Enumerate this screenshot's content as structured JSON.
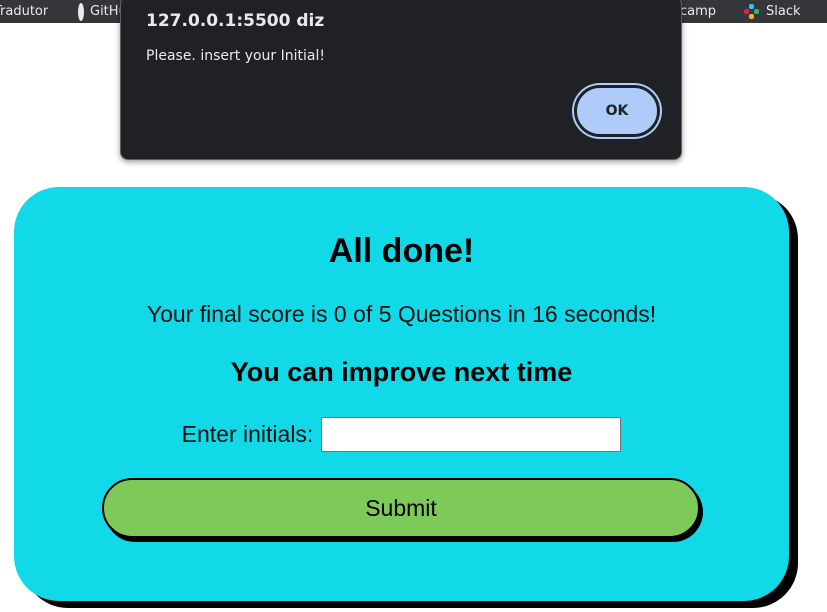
{
  "bookmarks": [
    {
      "label": "Tradutor",
      "icon": "translate-icon"
    },
    {
      "label": "GitHub",
      "icon": "github-icon"
    },
    {
      "label": "camp",
      "icon": "bookmark-icon"
    },
    {
      "label": "Slack",
      "icon": "slack-icon"
    }
  ],
  "dialog": {
    "title": "127.0.0.1:5500 diz",
    "message": "Please. insert your Initial!",
    "ok_label": "OK"
  },
  "quiz": {
    "title": "All done!",
    "score_text": "Your final score is 0 of 5 Questions in 16 seconds!",
    "subtitle": "You can improve next time",
    "initials_label": "Enter initials:",
    "initials_value": "",
    "initials_placeholder": "",
    "submit_label": "Submit"
  },
  "colors": {
    "card_bg": "#12d9e8",
    "submit_bg": "#7dc95a",
    "dialog_bg": "#202124",
    "ok_bg": "#aecbfa"
  }
}
